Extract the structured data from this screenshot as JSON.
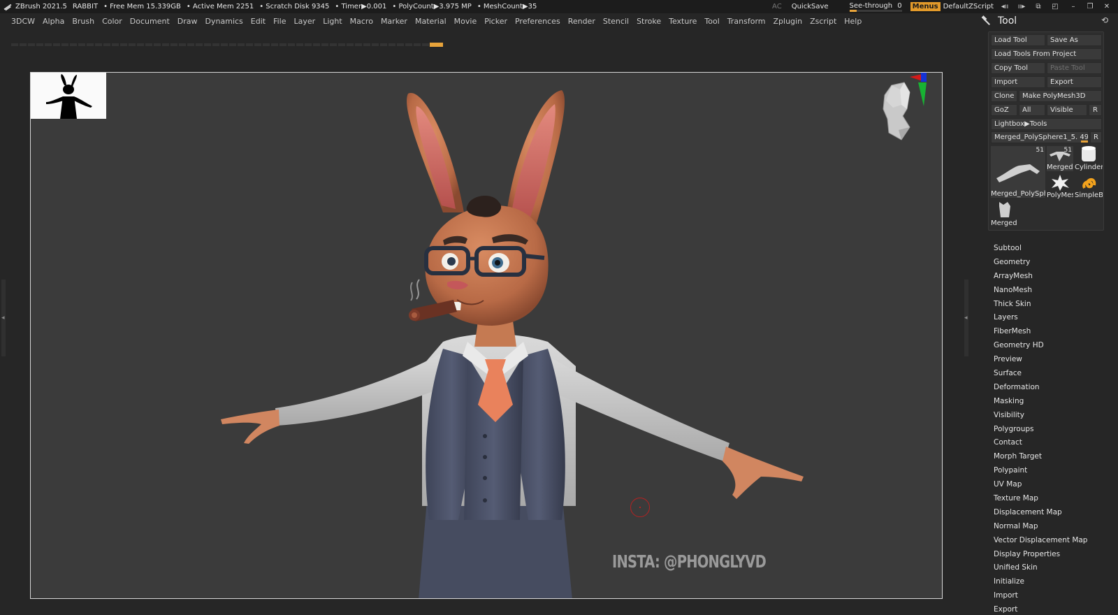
{
  "titlebar": {
    "app": "ZBrush 2021.5",
    "document": "RABBIT",
    "free_mem": "• Free Mem 15.339GB",
    "active_mem": "• Active Mem 2251",
    "scratch": "• Scratch Disk 9345",
    "timer": "• Timer▶0.001",
    "polycount": "• PolyCount▶3.975 MP",
    "meshcount": "• MeshCount▶35",
    "ac": "AC",
    "quicksave": "QuickSave",
    "seethrough_label": "See-through",
    "seethrough_value": "0",
    "menus": "Menus",
    "zscript": "DefaultZScript",
    "accent": "#e7a33a"
  },
  "menubar": [
    "3DCW",
    "Alpha",
    "Brush",
    "Color",
    "Document",
    "Draw",
    "Dynamics",
    "Edit",
    "File",
    "Layer",
    "Light",
    "Macro",
    "Marker",
    "Material",
    "Movie",
    "Picker",
    "Preferences",
    "Render",
    "Stencil",
    "Stroke",
    "Texture",
    "Tool",
    "Transform",
    "Zplugin",
    "Zscript",
    "Help"
  ],
  "viewport": {
    "watermark": "INSTA: @PHONGLYVD"
  },
  "tool": {
    "title": "Tool",
    "load_tool": "Load Tool",
    "save_as": "Save As",
    "load_from_project": "Load Tools From Project",
    "copy_tool": "Copy Tool",
    "paste_tool": "Paste Tool",
    "import": "Import",
    "export": "Export",
    "clone": "Clone",
    "make_polymesh": "Make PolyMesh3D",
    "goz": "GoZ",
    "all": "All",
    "visible": "Visible",
    "r": "R",
    "lightbox": "Lightbox▶Tools",
    "current_tool": "Merged_PolySphere1_5. 49",
    "thumbs": [
      {
        "caption": "Merged_PolySph",
        "count": "51"
      },
      {
        "caption": "Merged",
        "count": "51"
      },
      {
        "caption": "Cylinder",
        "count": ""
      },
      {
        "caption": "PolyMes",
        "count": ""
      },
      {
        "caption": "SimpleB",
        "count": ""
      },
      {
        "caption": "Merged",
        "count": ""
      }
    ],
    "subpalettes": [
      "Subtool",
      "Geometry",
      "ArrayMesh",
      "NanoMesh",
      "Thick Skin",
      "Layers",
      "FiberMesh",
      "Geometry HD",
      "Preview",
      "Surface",
      "Deformation",
      "Masking",
      "Visibility",
      "Polygroups",
      "Contact",
      "Morph Target",
      "Polypaint",
      "UV Map",
      "Texture Map",
      "Displacement Map",
      "Normal Map",
      "Vector Displacement Map",
      "Display Properties",
      "Unified Skin",
      "Initialize",
      "Import",
      "Export"
    ]
  }
}
